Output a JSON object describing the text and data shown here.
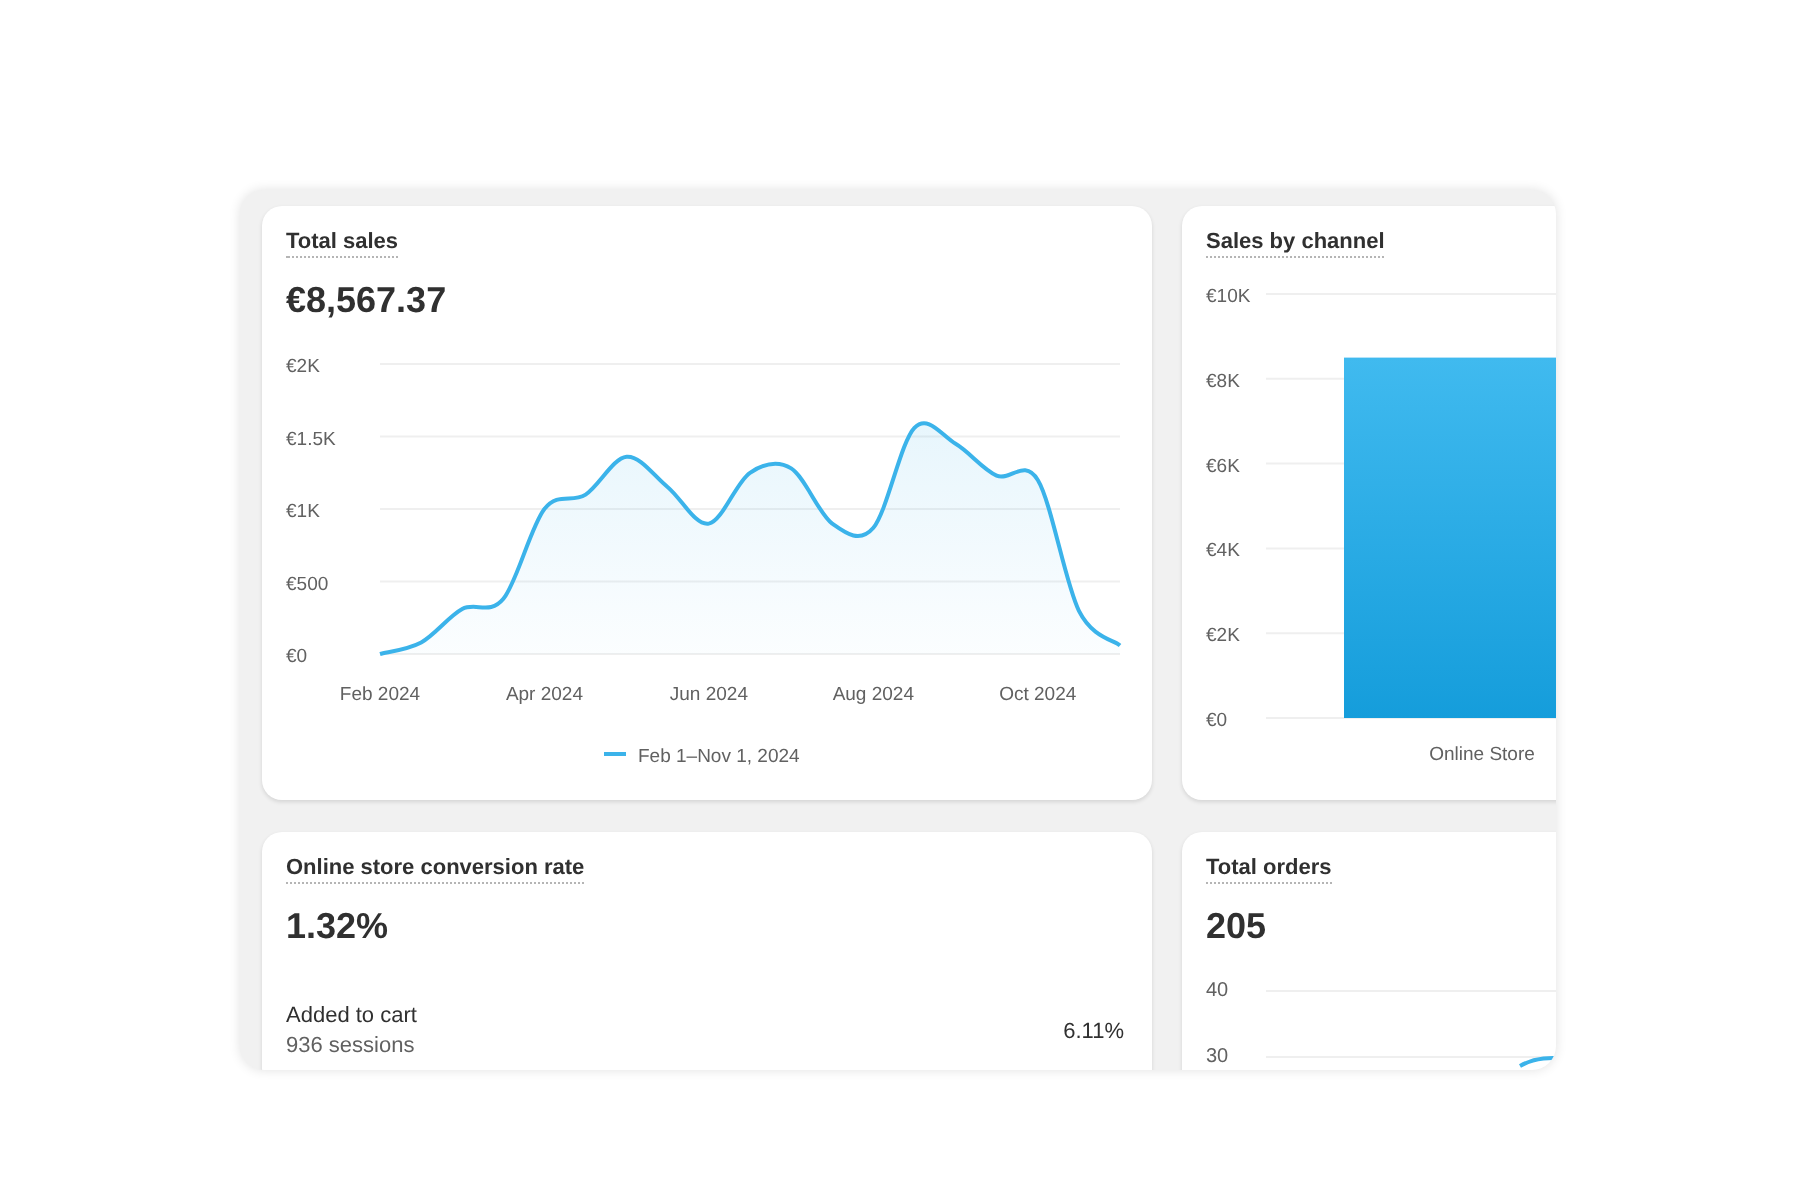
{
  "total_sales": {
    "title": "Total sales",
    "value": "€8,567.37",
    "chart_data": {
      "type": "line",
      "categories": [
        "Feb 2024",
        null,
        null,
        null,
        "Apr 2024",
        null,
        null,
        null,
        "Jun 2024",
        null,
        null,
        null,
        "Aug 2024",
        null,
        null,
        null,
        "Oct 2024",
        null,
        null
      ],
      "series": [
        {
          "name": "Feb 1–Nov 1, 2024",
          "color": "#3bb3ea",
          "values": [
            0,
            80,
            310,
            380,
            1000,
            1100,
            1360,
            1150,
            900,
            1250,
            1280,
            900,
            870,
            1560,
            1450,
            1230,
            1200,
            300,
            60
          ]
        }
      ],
      "ylim": [
        0,
        2000
      ],
      "grid": true,
      "yticks": [
        {
          "value": 0,
          "label": "€0"
        },
        {
          "value": 500,
          "label": "€500"
        },
        {
          "value": 1000,
          "label": "€1K"
        },
        {
          "value": 1500,
          "label": "€1.5K"
        },
        {
          "value": 2000,
          "label": "€2K"
        }
      ]
    }
  },
  "sales_by_channel": {
    "title": "Sales by channel",
    "chart_data": {
      "type": "bar",
      "categories": [
        "Online Store"
      ],
      "values": [
        8500
      ],
      "ylim": [
        0,
        10000
      ],
      "grid": true,
      "yticks": [
        {
          "value": 0,
          "label": "€0"
        },
        {
          "value": 2000,
          "label": "€2K"
        },
        {
          "value": 4000,
          "label": "€4K"
        },
        {
          "value": 6000,
          "label": "€6K"
        },
        {
          "value": 8000,
          "label": "€8K"
        },
        {
          "value": 10000,
          "label": "€10K"
        }
      ]
    }
  },
  "conversion": {
    "title": "Online store conversion rate",
    "value": "1.32%",
    "steps": [
      {
        "label": "Added to cart",
        "sessions": "936 sessions",
        "rate": "6.11%"
      }
    ]
  },
  "total_orders": {
    "title": "Total orders",
    "value": "205",
    "y_ticks": [
      "40",
      "30"
    ]
  }
}
